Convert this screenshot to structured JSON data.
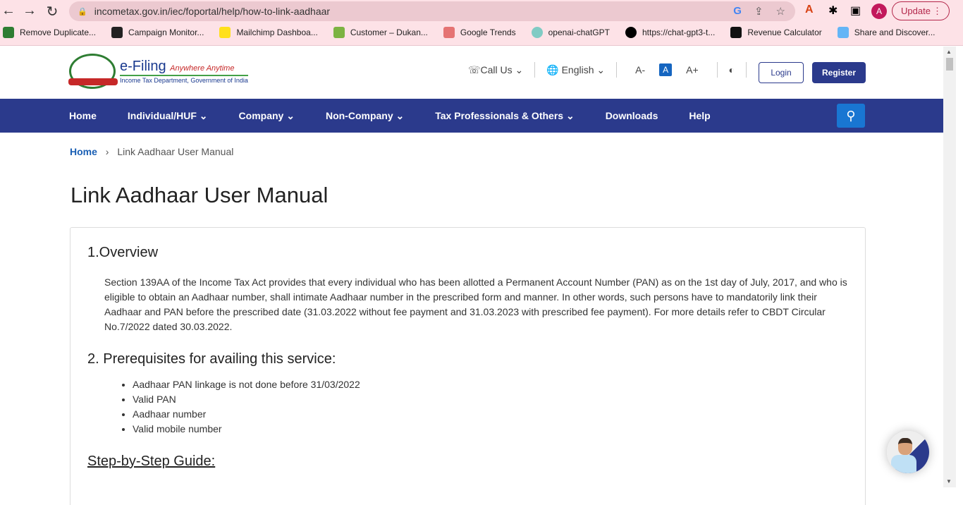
{
  "browser": {
    "url": "incometax.gov.in/iec/foportal/help/how-to-link-aadhaar",
    "update_label": "Update",
    "avatar": "A",
    "bookmarks": [
      "Remove Duplicate...",
      "Campaign Monitor...",
      "Mailchimp Dashboa...",
      "Customer – Dukan...",
      "Google Trends",
      "openai-chatGPT",
      "https://chat-gpt3-t...",
      "Revenue Calculator",
      "Share and Discover..."
    ],
    "more": "»"
  },
  "header": {
    "brand": "e-Filing",
    "tagline": "Anywhere Anytime",
    "dept": "Income Tax Department, Government of India",
    "call_us": "Call Us",
    "language": "English",
    "font_small": "A-",
    "font_normal": "A",
    "font_large": "A+",
    "login": "Login",
    "register": "Register"
  },
  "nav": [
    "Home",
    "Individual/HUF",
    "Company",
    "Non-Company",
    "Tax Professionals & Others",
    "Downloads",
    "Help"
  ],
  "breadcrumb": {
    "home": "Home",
    "sep": "›",
    "current": "Link Aadhaar User Manual"
  },
  "page_title": "Link Aadhaar User Manual",
  "content": {
    "h_overview": "1.Overview",
    "overview": "Section 139AA of the Income Tax Act provides that every individual who has been allotted a Permanent Account Number (PAN) as on the 1st day of July, 2017, and who is eligible to obtain an Aadhaar number, shall intimate Aadhaar number in the prescribed form and manner. In other words, such persons have to mandatorily link their Aadhaar and PAN before the prescribed date (31.03.2022 without fee payment and 31.03.2023 with prescribed fee payment). For more details refer to CBDT Circular No.7/2022 dated 30.03.2022.",
    "h_prereq": "2. Prerequisites for availing this service:",
    "prereqs": [
      "Aadhaar PAN linkage is not done before 31/03/2022",
      "Valid PAN",
      "Aadhaar number",
      "Valid mobile number"
    ],
    "h_guide": "Step-by-Step Guide:"
  },
  "colors": {
    "nav": "#2b3a8c",
    "accent": "#1976d2",
    "chrome": "#fde2e7"
  }
}
